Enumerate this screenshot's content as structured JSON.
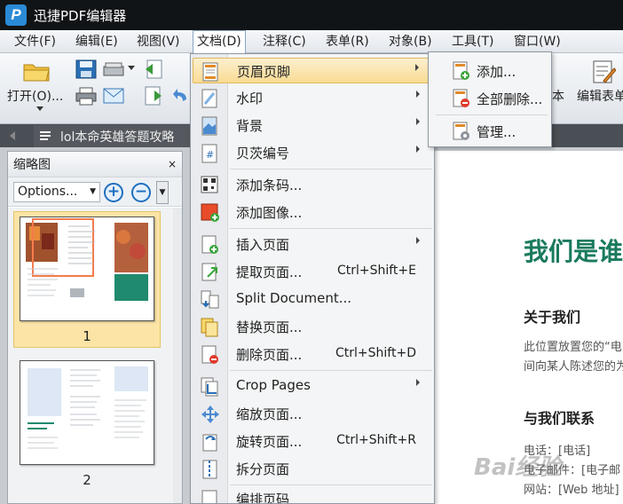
{
  "window": {
    "title": "迅捷PDF编辑器",
    "logo_letter": "P"
  },
  "menubar": [
    "文件(F)",
    "编辑(E)",
    "视图(V)",
    "文档(D)",
    "注释(C)",
    "表单(R)",
    "对象(B)",
    "工具(T)",
    "窗口(W)"
  ],
  "toolbar": {
    "open_label": "打开(O)...",
    "edit_form_label": "编辑表单",
    "text_label": "本"
  },
  "tab": {
    "title": "lol本命英雄答题攻略"
  },
  "thumbnail_panel": {
    "title": "缩略图",
    "close": "×",
    "options_label": "Options...",
    "zoom_in": "+",
    "zoom_out": "−",
    "pages": [
      "1",
      "2"
    ],
    "selected_page": "1"
  },
  "document_menu": {
    "items": [
      {
        "label": "页眉页脚",
        "submenu": true,
        "icon": "header-footer-icon"
      },
      {
        "label": "水印",
        "submenu": true,
        "icon": "watermark-icon"
      },
      {
        "label": "背景",
        "submenu": true,
        "icon": "background-icon"
      },
      {
        "label": "贝茨编号",
        "submenu": true,
        "icon": "bates-number-icon"
      },
      {
        "label": "添加条码...",
        "icon": "barcode-icon"
      },
      {
        "label": "添加图像...",
        "icon": "add-image-icon"
      },
      {
        "label": "插入页面",
        "submenu": true,
        "icon": "insert-page-icon"
      },
      {
        "label": "提取页面...",
        "shortcut": "Ctrl+Shift+E",
        "icon": "extract-page-icon"
      },
      {
        "label": "Split Document...",
        "icon": "split-document-icon"
      },
      {
        "label": "替换页面...",
        "icon": "replace-page-icon"
      },
      {
        "label": "删除页面...",
        "shortcut": "Ctrl+Shift+D",
        "icon": "delete-page-icon"
      },
      {
        "label": "Crop Pages",
        "submenu": true,
        "icon": "crop-pages-icon"
      },
      {
        "label": "缩放页面...",
        "icon": "resize-page-icon"
      },
      {
        "label": "旋转页面...",
        "shortcut": "Ctrl+Shift+R",
        "icon": "rotate-page-icon"
      },
      {
        "label": "拆分页面",
        "icon": "split-page-icon"
      },
      {
        "label": "编排页码",
        "icon": "page-numbering-icon"
      }
    ]
  },
  "header_footer_submenu": {
    "items": [
      {
        "label": "添加...",
        "icon": "add-header-icon"
      },
      {
        "label": "全部删除...",
        "icon": "remove-all-header-icon"
      },
      {
        "label": "管理...",
        "icon": "manage-header-icon"
      }
    ]
  },
  "document": {
    "heading": "我们是谁",
    "about_title": "关于我们",
    "about_line1": "此位置放置您的“电",
    "about_line2": "间向某人陈述您的为",
    "contact_title": "与我们联系",
    "phone_line": "电话：[电话]",
    "email_line": "电子邮件：[电子邮",
    "web_line": "网站：[Web 地址]"
  },
  "watermark": "Bai经验",
  "colors": {
    "accent_green": "#1a7a5e",
    "menu_highlight": "#f9db93",
    "title_bar": "#111417"
  }
}
